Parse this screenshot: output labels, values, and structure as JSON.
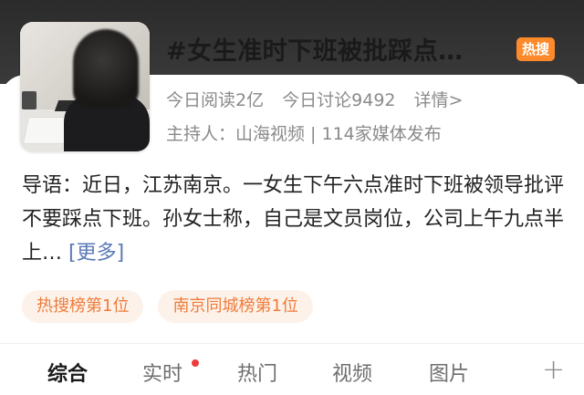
{
  "topic": {
    "title": "#女生准时下班被批踩点…",
    "badge": "热搜",
    "stats": {
      "read": "今日阅读2亿",
      "discuss": "今日讨论9492",
      "details": "详情>"
    },
    "host": "主持人：山海视频 | 114家媒体发布",
    "intro": "导语：近日，江苏南京。一女生下午六点准时下班被领导批评不要踩点下班。孙女士称，自己是文员岗位，公司上午九点半上…",
    "more": "[更多]"
  },
  "tags": [
    "热搜榜第1位",
    "南京同城榜第1位"
  ],
  "tabs": {
    "comprehensive": "综合",
    "realtime": "实时",
    "hot": "热门",
    "video": "视频",
    "images": "图片",
    "add": "+"
  },
  "colors": {
    "badge": "#ff8a2b",
    "tag_bg": "#fdf2ea",
    "tag_text": "#ef7b3a",
    "link": "#5b79b8",
    "dot": "#f03a3a"
  }
}
